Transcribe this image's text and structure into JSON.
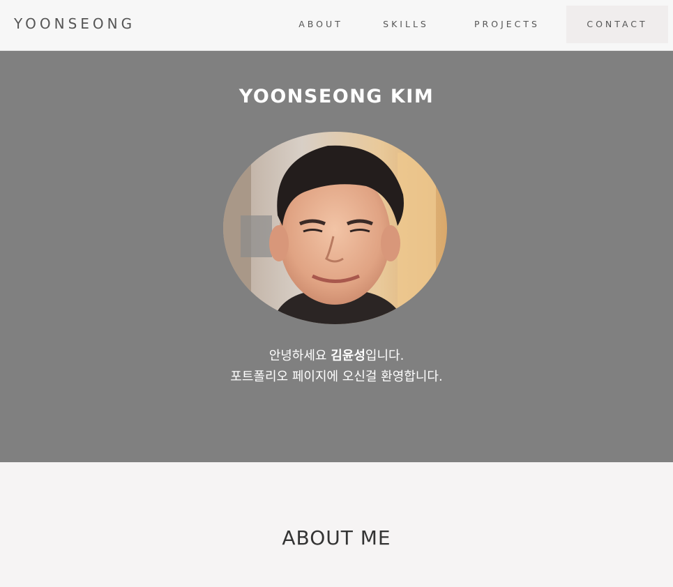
{
  "navbar": {
    "brand": "YOONSEONG",
    "items": [
      {
        "label": "ABOUT"
      },
      {
        "label": "SKILLS"
      },
      {
        "label": "PROJECTS"
      },
      {
        "label": "CONTACT"
      }
    ]
  },
  "hero": {
    "title": "YOONSEONG KIM",
    "intro_line1_prefix": "안녕하세요 ",
    "intro_line1_name": "김윤성",
    "intro_line1_suffix": "입니다.",
    "intro_line2": "포트폴리오 페이지에 오신걸 환영합니다."
  },
  "about": {
    "title": "ABOUT ME"
  },
  "colors": {
    "hero_bg": "#808080",
    "navbar_bg": "#f7f7f7",
    "page_bg": "#f6f4f4",
    "nav_text": "#555555"
  }
}
